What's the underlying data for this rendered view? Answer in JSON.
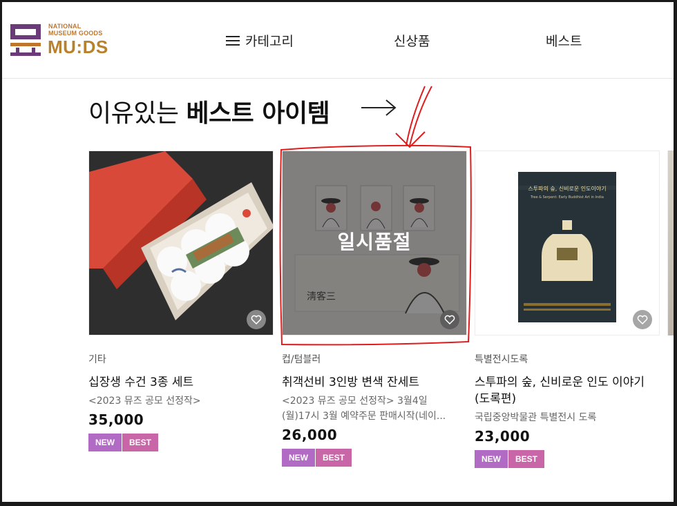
{
  "header": {
    "logo": {
      "subtitle": "NATIONAL\nMUSEUM GOODS",
      "brand": "MU:DS"
    },
    "nav": [
      {
        "label": "카테고리",
        "icon": "menu-icon"
      },
      {
        "label": "신상품"
      },
      {
        "label": "베스트"
      }
    ]
  },
  "section": {
    "title_light": "이유있는 ",
    "title_bold": "베스트 아이템",
    "arrow_icon": "arrow-right-icon"
  },
  "products": [
    {
      "category": "기타",
      "name": "십장생 수건 3종 세트",
      "desc": "<2023 뮤즈 공모 선정작>",
      "price": "35,000",
      "badges": [
        "NEW",
        "BEST"
      ],
      "sold_out": false
    },
    {
      "category": "컵/텀블러",
      "name": "취객선비 3인방 변색 잔세트",
      "desc": "<2023 뮤즈 공모 선정작> 3월4일 (월)17시 3월 예약주문 판매시작(네이...",
      "price": "26,000",
      "badges": [
        "NEW",
        "BEST"
      ],
      "sold_out": true,
      "sold_out_label": "일시품절"
    },
    {
      "category": "특별전시도록",
      "name": "스투파의 숲, 신비로운 인도 이야기 (도록편)",
      "desc": "국립중앙박물관 특별전시 도록",
      "price": "23,000",
      "badges": [
        "NEW",
        "BEST"
      ],
      "sold_out": false,
      "book_title": "스투파의 숲, 신비로운 인도이야기",
      "book_subtitle": "Tree & Serpent: Early Buddhist Art in India"
    }
  ],
  "colors": {
    "brand_purple": "#6b3a78",
    "brand_gold": "#b8812e",
    "badge_new": "#b26bc4",
    "badge_best": "#c966a8",
    "annotation_red": "#e01c1c"
  }
}
